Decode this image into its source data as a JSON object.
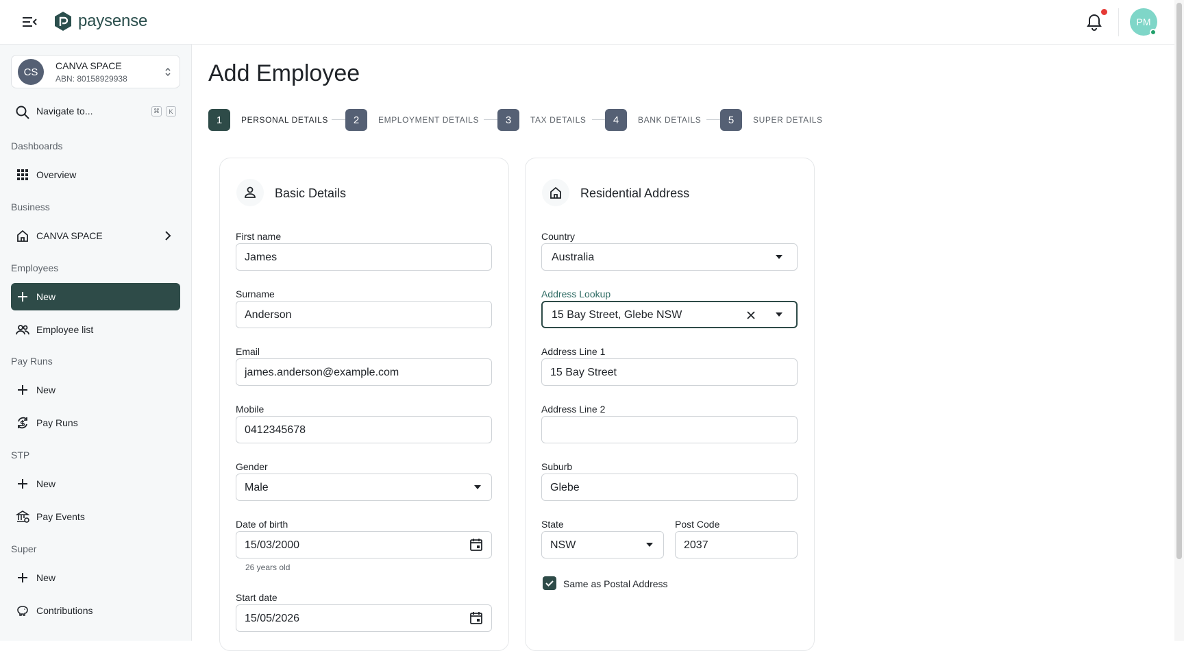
{
  "app": {
    "brand": "paysense",
    "user_initials": "PM"
  },
  "org": {
    "initials": "CS",
    "name": "CANVA SPACE",
    "abn": "ABN: 80158929938"
  },
  "nav": {
    "search_label": "Navigate to...",
    "kbd1": "⌘",
    "kbd2": "K",
    "sections": {
      "dashboards": "Dashboards",
      "business": "Business",
      "employees": "Employees",
      "payruns": "Pay Runs",
      "stp": "STP",
      "super": "Super"
    },
    "items": {
      "overview": "Overview",
      "business_space": "CANVA SPACE",
      "employees_new": "New",
      "employee_list": "Employee list",
      "payruns_new": "New",
      "pay_runs": "Pay Runs",
      "stp_new": "New",
      "pay_events": "Pay Events",
      "super_new": "New",
      "contributions": "Contributions"
    }
  },
  "page": {
    "title": "Add Employee"
  },
  "steps": [
    {
      "num": "1",
      "label": "PERSONAL DETAILS"
    },
    {
      "num": "2",
      "label": "EMPLOYMENT DETAILS"
    },
    {
      "num": "3",
      "label": "TAX DETAILS"
    },
    {
      "num": "4",
      "label": "BANK DETAILS"
    },
    {
      "num": "5",
      "label": "SUPER DETAILS"
    }
  ],
  "basic": {
    "title": "Basic Details",
    "first_name_label": "First name",
    "first_name": "James",
    "surname_label": "Surname",
    "surname": "Anderson",
    "email_label": "Email",
    "email": "james.anderson@example.com",
    "mobile_label": "Mobile",
    "mobile": "0412345678",
    "gender_label": "Gender",
    "gender": "Male",
    "dob_label": "Date of birth",
    "dob": "15/03/2000",
    "age": "26 years old",
    "start_label": "Start date",
    "start": "15/05/2026"
  },
  "address": {
    "title": "Residential Address",
    "country_label": "Country",
    "country": "Australia",
    "lookup_label": "Address Lookup",
    "lookup": "15 Bay Street, Glebe NSW",
    "line1_label": "Address Line 1",
    "line1": "15 Bay Street",
    "line2_label": "Address Line 2",
    "line2": "",
    "suburb_label": "Suburb",
    "suburb": "Glebe",
    "state_label": "State",
    "state": "NSW",
    "postcode_label": "Post Code",
    "postcode": "2037",
    "same_postal_label": "Same as Postal Address"
  }
}
